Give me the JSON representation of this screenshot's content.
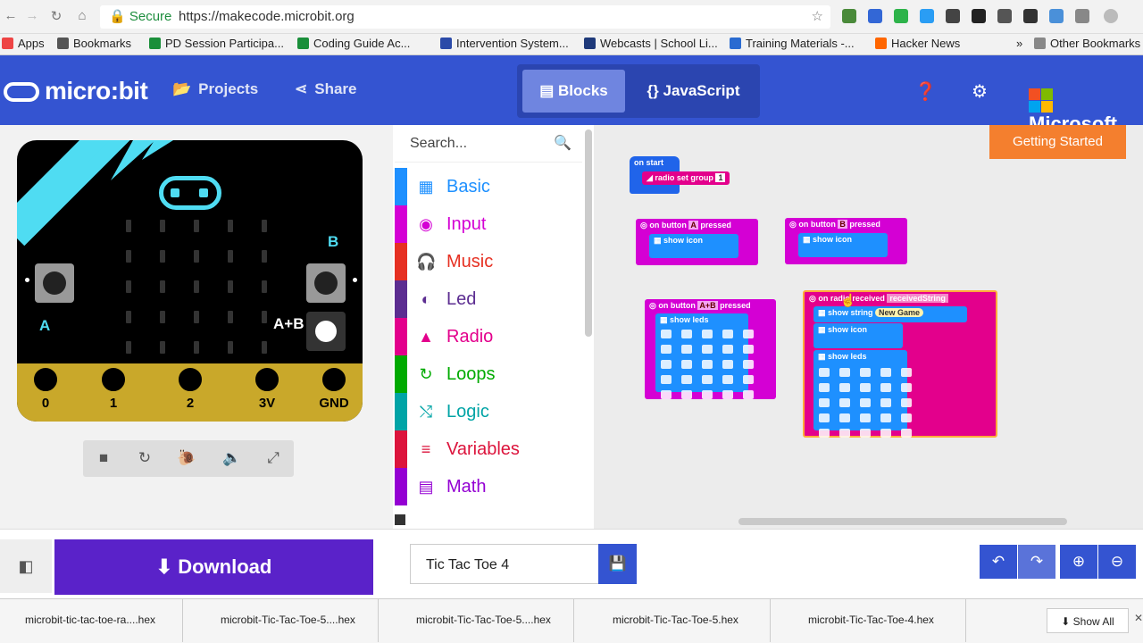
{
  "browser": {
    "secure_label": "Secure",
    "url": "https://makecode.microbit.org",
    "bookmarks": [
      "Apps",
      "Bookmarks",
      "PD Session Participa...",
      "Coding Guide Ac...",
      "Intervention System...",
      "Webcasts | School Li...",
      "Training Materials -...",
      "Hacker News"
    ],
    "other_bookmarks": "Other Bookmarks"
  },
  "header": {
    "logo": "micro:bit",
    "projects": "Projects",
    "share": "Share",
    "blocks": "Blocks",
    "javascript": "JavaScript",
    "microsoft": "Microsoft"
  },
  "simulator": {
    "pins": [
      "0",
      "1",
      "2",
      "3V",
      "GND"
    ],
    "label_a": "A",
    "label_b": "B",
    "label_ab": "A+B"
  },
  "toolbox": {
    "search_placeholder": "Search...",
    "categories": [
      {
        "label": "Basic",
        "color": "#1e90ff",
        "icon": "▦"
      },
      {
        "label": "Input",
        "color": "#d400d4",
        "icon": "◉"
      },
      {
        "label": "Music",
        "color": "#e63022",
        "icon": "🎧"
      },
      {
        "label": "Led",
        "color": "#5c2d91",
        "icon": "◐"
      },
      {
        "label": "Radio",
        "color": "#e3008c",
        "icon": "▲"
      },
      {
        "label": "Loops",
        "color": "#00aa00",
        "icon": "↻"
      },
      {
        "label": "Logic",
        "color": "#00a4a6",
        "icon": "⤭"
      },
      {
        "label": "Variables",
        "color": "#dc143c",
        "icon": "≡"
      },
      {
        "label": "Math",
        "color": "#9400d3",
        "icon": "▤"
      }
    ]
  },
  "workspace": {
    "getting_started": "Getting Started",
    "on_start": "on start",
    "radio_set_group": "radio set group",
    "group_value": "1",
    "on_button": "on button",
    "pressed": "pressed",
    "btn_a": "A",
    "btn_b": "B",
    "btn_ab": "A+B",
    "show_icon": "show icon",
    "show_leds": "show leds",
    "on_radio_received": "on radio received",
    "received_string": "receivedString",
    "show_string": "show string",
    "new_game": "New Game"
  },
  "bottom": {
    "download": "Download",
    "project_name": "Tic Tac Toe 4"
  },
  "downloads": {
    "files": [
      "microbit-tic-tac-toe-ra....hex",
      "microbit-Tic-Tac-Toe-5....hex",
      "microbit-Tic-Tac-Toe-5....hex",
      "microbit-Tic-Tac-Toe-5.hex",
      "microbit-Tic-Tac-Toe-4.hex"
    ],
    "show_all": "Show All"
  }
}
